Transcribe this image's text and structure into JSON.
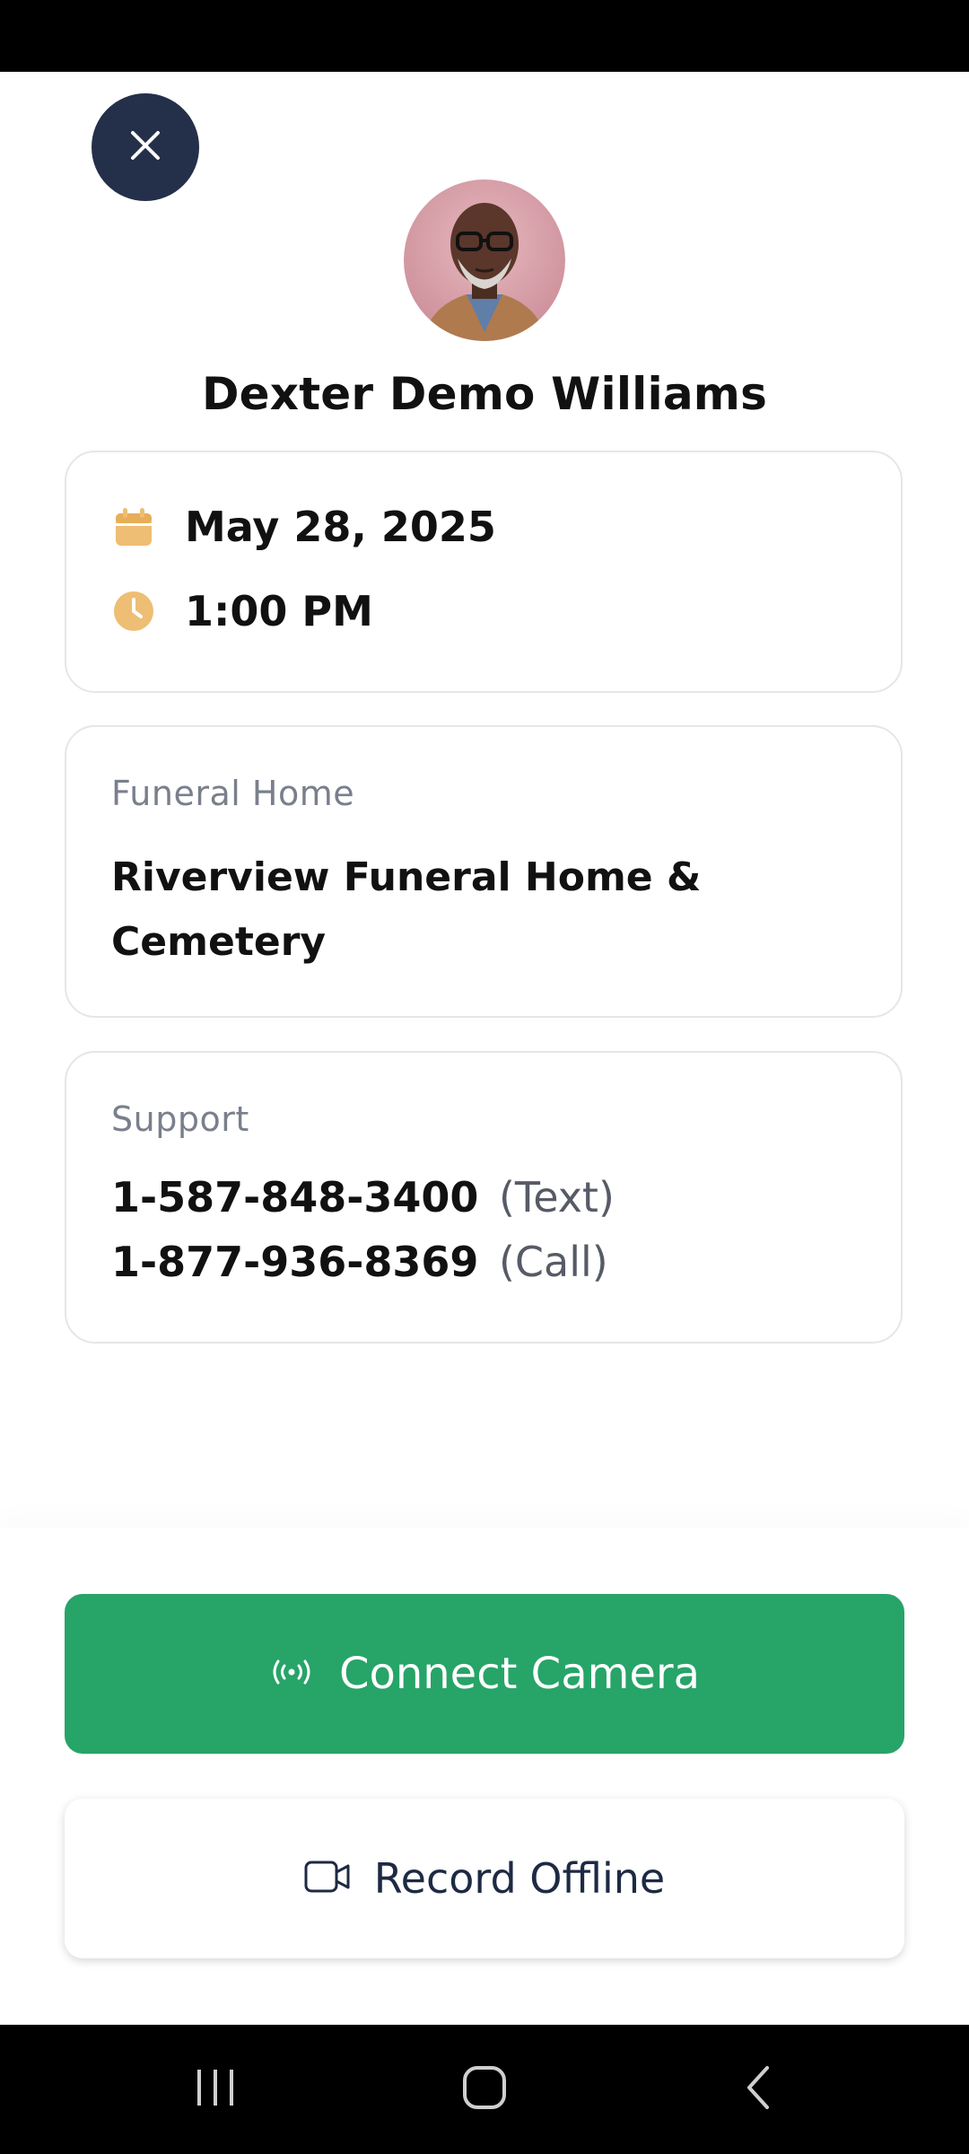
{
  "header": {
    "close_icon": "close-icon",
    "avatar_alt": "profile photo",
    "name": "Dexter Demo Williams"
  },
  "schedule": {
    "date": "May 28, 2025",
    "time": "1:00 PM",
    "date_icon": "calendar-icon",
    "time_icon": "clock-icon",
    "icon_color": "#EDBE73"
  },
  "funeral_home": {
    "label": "Funeral Home",
    "name": "Riverview Funeral Home & Cemetery"
  },
  "support": {
    "label": "Support",
    "lines": [
      {
        "number": "1-587-848-3400",
        "kind": "(Text)"
      },
      {
        "number": "1-877-936-8369",
        "kind": "(Call)"
      }
    ]
  },
  "actions": {
    "connect_label": "Connect Camera",
    "connect_icon": "broadcast-icon",
    "connect_color": "#27A468",
    "record_label": "Record Offline",
    "record_icon": "video-camera-icon"
  },
  "system_nav": {
    "recents_icon": "recents-icon",
    "home_icon": "home-icon",
    "back_icon": "back-icon"
  }
}
